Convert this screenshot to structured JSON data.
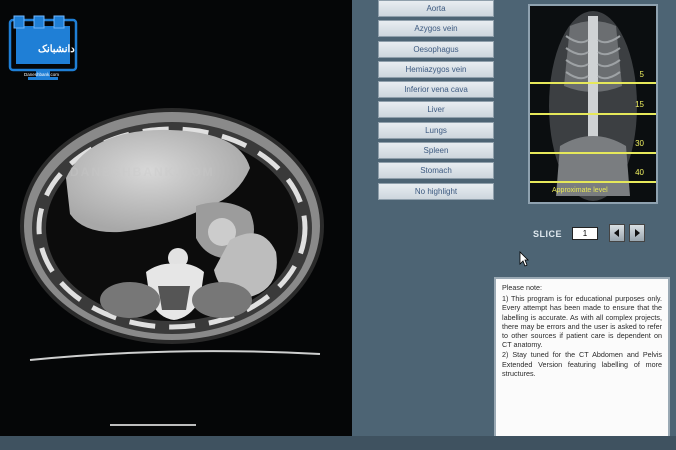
{
  "watermark": "DANESHBANK.COM",
  "logo": {
    "text": "دانشبانک",
    "subtext": "Daneshbank.com"
  },
  "structures": [
    "Aorta",
    "Azygos vein",
    "Oesophagus",
    "Hemiazygos vein",
    "Inferior vena cava",
    "Liver",
    "Lungs",
    "Spleen",
    "Stomach",
    "No highlight"
  ],
  "scout": {
    "levels": [
      "5",
      "15",
      "30",
      "40"
    ],
    "caption": "Approximate level"
  },
  "slice": {
    "label": "SLICE",
    "value": "1"
  },
  "note": {
    "title": "Please note:",
    "paragraphs": [
      "1) This program is for educational purposes only. Every attempt has been made to ensure that the labelling is accurate. As with all complex projects, there may be errors and the user is asked to refer to other sources if patient care is dependent on CT anatomy.",
      "2) Stay tuned for the CT Abdomen and Pelvis Extended Version featuring labelling of more structures."
    ]
  },
  "colors": {
    "background": "#4d6474",
    "button_text": "#3d5a80",
    "level_line": "#e6e85a"
  }
}
